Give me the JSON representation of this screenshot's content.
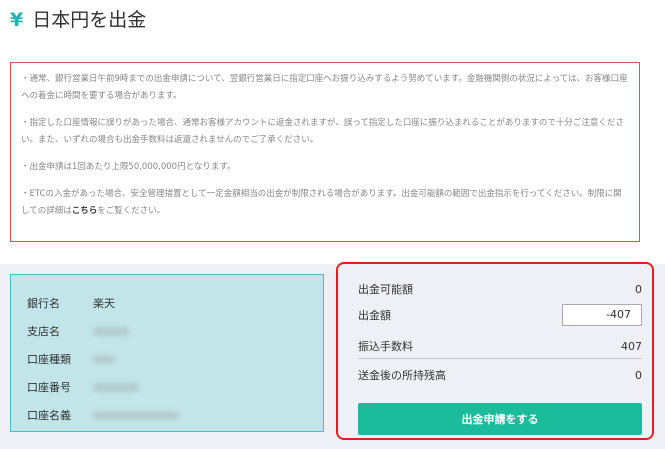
{
  "header": {
    "title": "日本円を出金",
    "icon": "yen-icon",
    "icon_glyph": "¥",
    "accent": "#22b3b3"
  },
  "notice": {
    "paragraphs": [
      "・通常、銀行営業日午前9時までの出金申請について、翌銀行営業日に指定口座へお振り込みするよう努めています。金融機関側の状況によっては、お客様口座への着金に時間を要する場合があります。",
      "・指定した口座情報に誤りがあった場合、通常お客様アカウントに返金されますが、誤って指定した口座に振り込まれることがありますので十分ご注意ください。また、いずれの場合も出金手数料は返還されませんのでご了承ください。",
      "・出金申請は1回あたり上限50,000,000円となります。"
    ],
    "last_paragraph_prefix": "・ETCの入金があった場合、安全管理措置として一定金額相当の出金が制限される場合があります。出金可能額の範囲で出金指示を行ってください。制限に関しての詳細は",
    "link_text": "こちら",
    "last_paragraph_suffix": "をご覧ください。",
    "border_color": "#d9534f"
  },
  "bank": {
    "rows": [
      {
        "label": "銀行名",
        "value": "楽天"
      },
      {
        "label": "支店名",
        "value": ""
      },
      {
        "label": "口座種類",
        "value": ""
      },
      {
        "label": "口座番号",
        "value": ""
      },
      {
        "label": "口座名義",
        "value": ""
      }
    ]
  },
  "withdraw": {
    "available_label": "出金可能額",
    "available_value": "0",
    "amount_label": "出金額",
    "amount_value": "-407",
    "fee_label": "振込手数料",
    "fee_value": "407",
    "balance_label": "送金後の所持残高",
    "balance_value": "0",
    "submit_label": "出金申請をする",
    "button_color": "#1abc9c"
  }
}
